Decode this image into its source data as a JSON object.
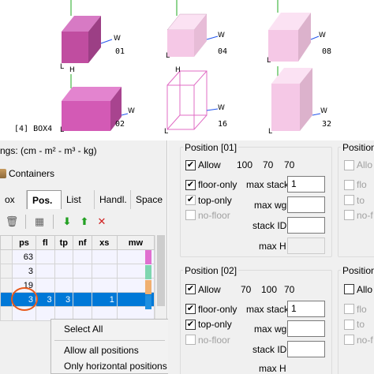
{
  "viewer": {
    "boxes": [
      {
        "label": "01"
      },
      {
        "label": "04"
      },
      {
        "label": "08"
      },
      {
        "label": "02"
      },
      {
        "label": "16"
      },
      {
        "label": "32"
      }
    ],
    "axis_w": "W",
    "axis_h": "H",
    "axis_l": "L",
    "caption": "[4] BOX4"
  },
  "left": {
    "settings_title": "ngs: (cm - m² - m³ - kg)",
    "containers_label": "Containers",
    "tabs": [
      "ox",
      "Pos.",
      "List",
      "Handl.",
      "Space"
    ],
    "active_tab": "Pos.",
    "columns": [
      "ps",
      "fl",
      "tp",
      "nf",
      "xs",
      "mw"
    ],
    "rows": [
      {
        "ps": "63",
        "fl": "",
        "tp": "",
        "nf": "",
        "xs": "",
        "mw": ""
      },
      {
        "ps": "3",
        "fl": "",
        "tp": "",
        "nf": "",
        "xs": "",
        "mw": ""
      },
      {
        "ps": "19",
        "fl": "",
        "tp": "",
        "nf": "",
        "xs": "",
        "mw": ""
      },
      {
        "ps": "3",
        "fl": "3",
        "tp": "3",
        "nf": "",
        "xs": "1",
        "mw": ""
      },
      {
        "ps": "",
        "fl": "",
        "tp": "",
        "nf": "",
        "xs": "",
        "mw": ""
      }
    ],
    "row_colors": [
      "#e070d0",
      "#7fd6b0",
      "#f0b070",
      "#1e8fe0"
    ],
    "context_menu": [
      "Select All",
      "Allow all positions",
      "Only horizontal positions"
    ]
  },
  "positions": [
    {
      "title": "Position [01]",
      "allow_label": "Allow",
      "allow_checked": true,
      "dims": [
        "100",
        "70",
        "70"
      ],
      "floor_only": true,
      "top_only": true,
      "no_floor": false,
      "max_stack": "1",
      "max_wg": "",
      "stack_id": "",
      "max_h": ""
    },
    {
      "title": "Position [02]",
      "allow_label": "Allow",
      "allow_checked": true,
      "dims": [
        "70",
        "100",
        "70"
      ],
      "floor_only": true,
      "top_only": true,
      "no_floor": false,
      "max_stack": "1",
      "max_wg": "",
      "stack_id": "",
      "max_h": ""
    }
  ],
  "positions_partial": [
    {
      "title": "Position",
      "allow": "Allo",
      "floor": "flo",
      "top": "to",
      "nofloor": "no-f"
    },
    {
      "title": "Position",
      "allow": "Allo",
      "floor": "flo",
      "top": "to",
      "nofloor": "no-f"
    }
  ],
  "labels": {
    "floor_only": "floor-only",
    "top_only": "top-only",
    "no_floor": "no-floor",
    "max_stack": "max stack",
    "max_wg": "max wg",
    "stack_id": "stack ID",
    "max_h": "max H"
  },
  "colors": {
    "box_dark": "#c04da0",
    "box_light": "#f5c8e6",
    "selection": "#0078d7",
    "annotation": "#e85a1c",
    "axis_green": "#22aa22",
    "axis_blue": "#2255ee"
  }
}
